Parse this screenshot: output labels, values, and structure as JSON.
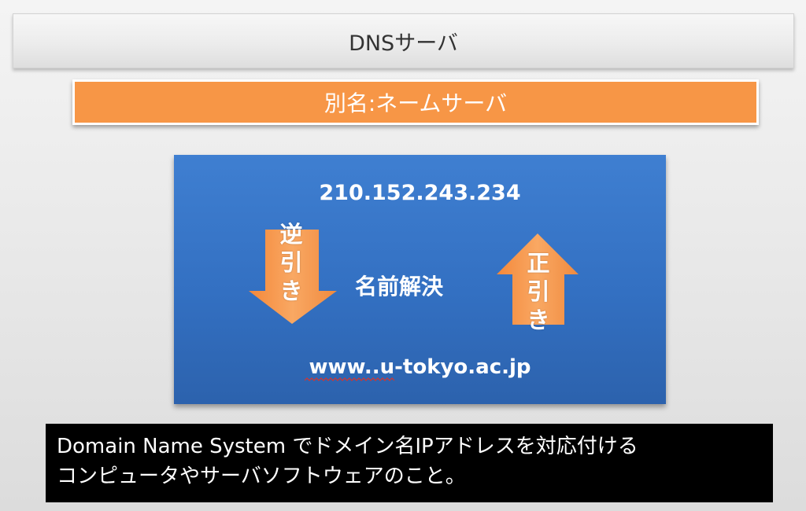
{
  "header": {
    "title": "DNSサーバ"
  },
  "subtitle": {
    "text": "別名:ネームサーバ"
  },
  "diagram": {
    "ip_address": "210.152.243.234",
    "center_label": "名前解決",
    "domain_name": "www..u-tokyo.ac.jp",
    "reverse_lookup": {
      "chars": [
        "逆",
        "引",
        "き"
      ],
      "direction": "down",
      "icon": "down-arrow-icon"
    },
    "forward_lookup": {
      "chars": [
        "正",
        "引",
        "き"
      ],
      "direction": "up",
      "icon": "up-arrow-icon"
    },
    "colors": {
      "box": "#3370c2",
      "arrow": "#f79646",
      "text": "#ffffff"
    }
  },
  "caption": {
    "line1": "Domain Name System でドメイン名IPアドレスを対応付ける",
    "line2": "コンピュータやサーバソフトウェアのこと。"
  }
}
